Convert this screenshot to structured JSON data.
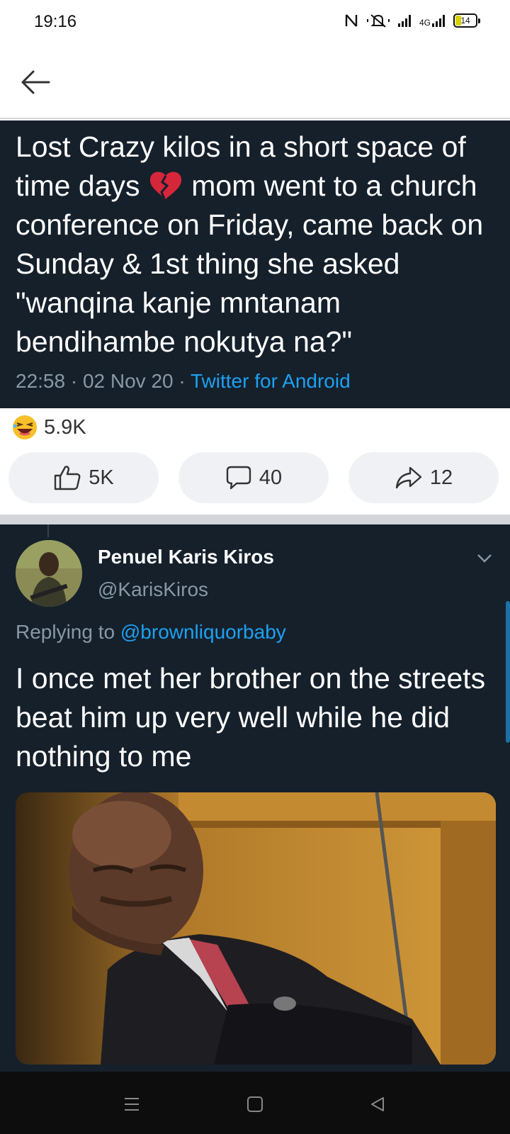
{
  "status_bar": {
    "time": "19:16",
    "network": "4G",
    "battery": "14"
  },
  "tweet": {
    "text_before_emoji": "Lost Crazy kilos in a short space of time days ",
    "emoji": "broken-heart-icon",
    "text_after_emoji": " mom went to a church conference on Friday, came back on Sunday & 1st thing she asked \"wanqina kanje mntanam bendihambe nokutya na?\"",
    "time": "22:58",
    "date": "02 Nov 20",
    "source": "Twitter for Android",
    "separator": " · "
  },
  "reactions": {
    "emoji": "laughing-face-icon",
    "count": "5.9K"
  },
  "actions": {
    "like_count": "5K",
    "comment_count": "40",
    "share_count": "12"
  },
  "reply": {
    "name": "Penuel Karis Kiros",
    "handle": "@KarisKiros",
    "replying_label": "Replying to ",
    "replying_to": "@brownliquorbaby",
    "text": "I once met her brother on the streets beat him up very well while he did nothing to me"
  },
  "colors": {
    "tweet_bg": "#15202b",
    "link": "#1da1f2",
    "meta": "#8899a6"
  }
}
